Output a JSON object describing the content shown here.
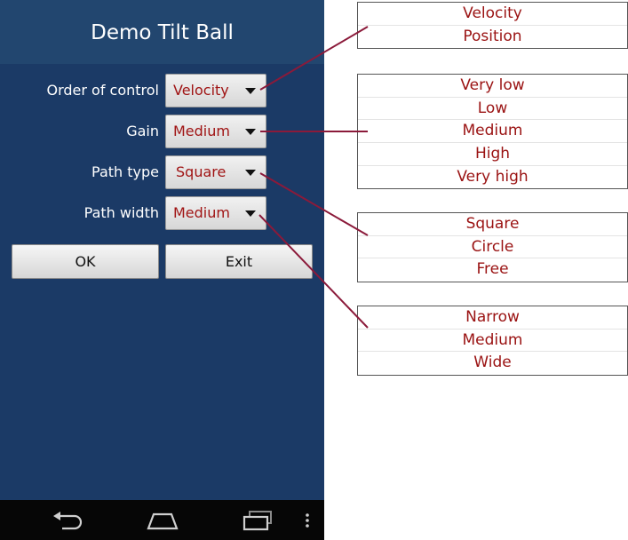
{
  "app": {
    "title": "Demo Tilt Ball"
  },
  "form": {
    "rows": [
      {
        "label": "Order of control",
        "value": "Velocity"
      },
      {
        "label": "Gain",
        "value": "Medium"
      },
      {
        "label": "Path type",
        "value": "Square"
      },
      {
        "label": "Path width",
        "value": "Medium"
      }
    ],
    "ok_label": "OK",
    "exit_label": "Exit"
  },
  "options": {
    "order_of_control": [
      "Velocity",
      "Position"
    ],
    "gain": [
      "Very low",
      "Low",
      "Medium",
      "High",
      "Very high"
    ],
    "path_type": [
      "Square",
      "Circle",
      "Free"
    ],
    "path_width": [
      "Narrow",
      "Medium",
      "Wide"
    ]
  },
  "colors": {
    "background": "#1b3a66",
    "titlebar": "#22466f",
    "value_text": "#a01414",
    "leader_line": "#8b1a3a",
    "navbar": "#060606"
  },
  "navbar": {
    "icons": [
      "back-icon",
      "home-icon",
      "recent-apps-icon",
      "overflow-menu-icon"
    ]
  }
}
